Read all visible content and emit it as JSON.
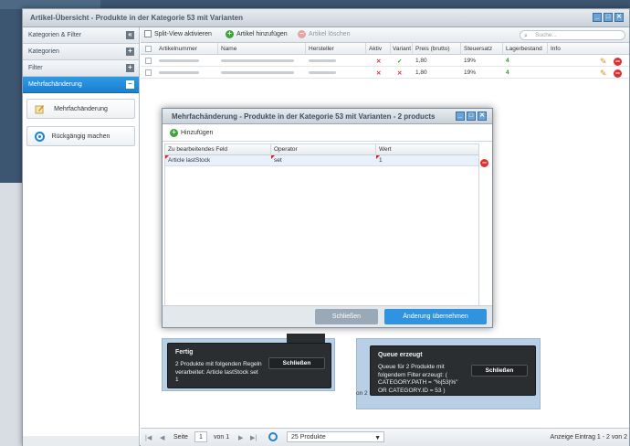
{
  "window": {
    "title": "Artikel-Übersicht - Produkte in der Kategorie 53 mit Varianten"
  },
  "sidebar": {
    "sections": [
      {
        "label": "Kategorien & Filter",
        "toggle": "«"
      },
      {
        "label": "Kategorien",
        "toggle": "+"
      },
      {
        "label": "Filter",
        "toggle": "+"
      },
      {
        "label": "Mehrfachänderung",
        "toggle": "−"
      }
    ],
    "buttons": [
      {
        "label": "Mehrfachänderung"
      },
      {
        "label": "Rückgängig machen"
      }
    ]
  },
  "toolbar": {
    "split_view": "Split-View aktivieren",
    "add": "Artikel hinzufügen",
    "delete": "Artikel löschen",
    "search_placeholder": "Suche..."
  },
  "grid": {
    "columns": [
      "Artikelnummer",
      "Name",
      "Hersteller",
      "Aktiv",
      "Variant",
      "Preis (brutto)",
      "Steuersatz",
      "Lagerbestand",
      "Info"
    ],
    "rows": [
      {
        "aktiv": "✕",
        "variant": "✓",
        "preis": "1,80",
        "steuer": "19%",
        "lager": "4"
      },
      {
        "aktiv": "✕",
        "variant": "✕",
        "preis": "1,80",
        "steuer": "19%",
        "lager": "4"
      }
    ]
  },
  "pager": {
    "page_label": "Seite",
    "page": "1",
    "of": "von 1",
    "per_page": "25 Produkte",
    "summary": "Anzeige Eintrag 1 - 2 von 2"
  },
  "dialog": {
    "title": "Mehrfachänderung - Produkte in der Kategorie 53 mit Varianten - 2 products",
    "add": "Hinzufügen",
    "columns": [
      "Zu bearbeitendes Feld",
      "Operator",
      "Wert"
    ],
    "rows": [
      {
        "field": "Article lastStock",
        "operator": "set",
        "value": "1"
      }
    ],
    "close": "Schließen",
    "apply": "Änderung übernehmen"
  },
  "toasts": [
    {
      "title": "Fertig",
      "lines": [
        "2 Produkte mit folgenden Regeln",
        "verarbeitet: Article lastStock set",
        "1"
      ],
      "close": "Schließen"
    },
    {
      "title": "Queue erzeugt",
      "lines": [
        "Queue für 2 Produkte mit",
        "folgendem Filter erzeugt: (",
        "CATEGORY.PATH = \"%|53|%\"",
        "OR CATEGORY.ID = 53 )"
      ],
      "close": "Schließen"
    }
  ],
  "fragment": {
    "text": "on 2"
  },
  "colors": {
    "accent": "#1a7fcf",
    "apply": "#2f93e0",
    "close_disabled": "#9aa9b7"
  }
}
